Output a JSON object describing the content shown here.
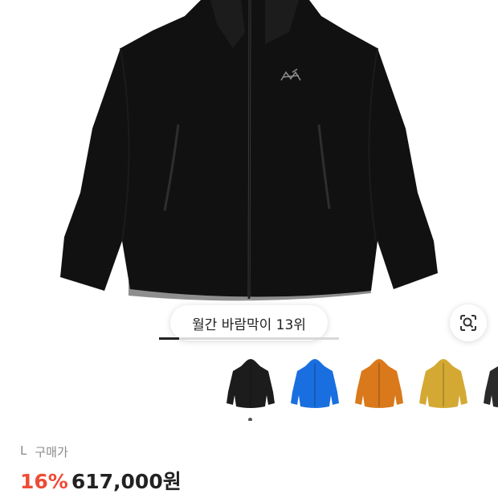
{
  "product": {
    "rank_label": "월간 바람막이 13위",
    "size": "L",
    "price_type_label": "구매가",
    "discount_percent": "16%",
    "price": "617,000원"
  },
  "image_carousel": {
    "progress": 0.11,
    "selected_index": 0
  },
  "color_thumbnails": [
    {
      "name": "black-jacket",
      "color": "#1c1c1c"
    },
    {
      "name": "blue-jacket",
      "color": "#1a6fe0"
    },
    {
      "name": "orange-jacket",
      "color": "#d9791c"
    },
    {
      "name": "yellow-jacket",
      "color": "#d4a933"
    },
    {
      "name": "dark-jacket",
      "color": "#2a2a2a"
    }
  ],
  "colors": {
    "discount": "#ef4b36",
    "text": "#222222",
    "muted": "#8a8a8a"
  },
  "icons": [
    "arcteryx-logo",
    "lens-search-icon"
  ]
}
